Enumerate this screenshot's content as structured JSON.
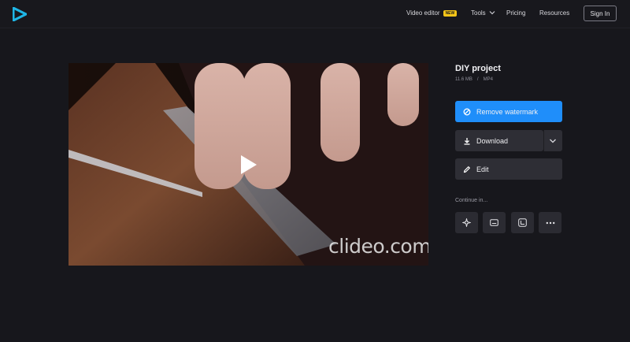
{
  "header": {
    "nav": {
      "video_editor": "Video editor",
      "new_badge": "NEW",
      "tools": "Tools",
      "pricing": "Pricing",
      "resources": "Resources"
    },
    "sign_in": "Sign In"
  },
  "video": {
    "watermark": "clideo.com"
  },
  "file": {
    "title": "DIY project",
    "size": "11.6 MB",
    "separator": "/",
    "format": "MP4"
  },
  "actions": {
    "remove_watermark": "Remove watermark",
    "download": "Download",
    "edit": "Edit"
  },
  "continue": {
    "label": "Continue in...",
    "tools": [
      "sparkle-icon",
      "subtitles-icon",
      "crop-icon",
      "more-icon"
    ]
  },
  "colors": {
    "background": "#17171c",
    "primary": "#1f8efa",
    "button_dark": "#2e2e35",
    "badge": "#f5c518",
    "logo": "#1fb6e6"
  }
}
